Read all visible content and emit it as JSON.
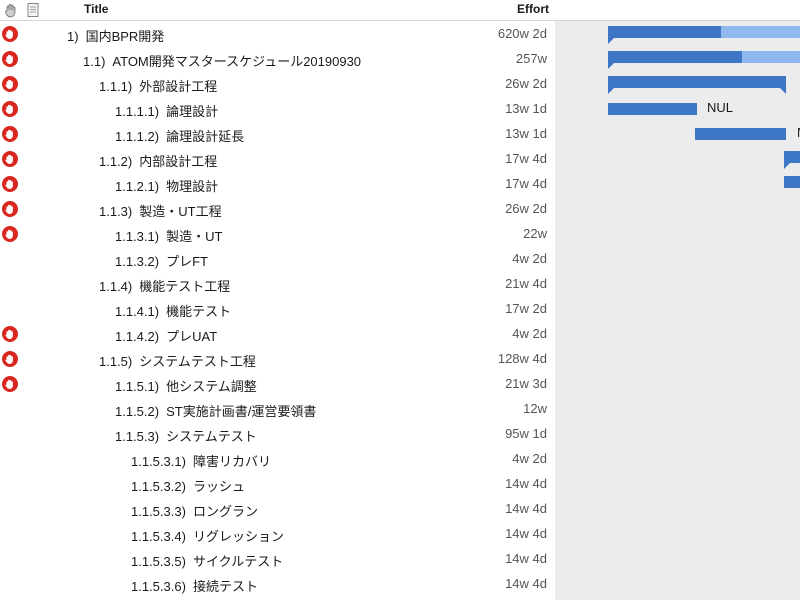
{
  "header": {
    "title_label": "Title",
    "effort_label": "Effort",
    "icons": [
      "hand-icon",
      "document-icon"
    ]
  },
  "colors": {
    "status_red": "#d8271f",
    "bar_dark": "#3d76c4",
    "bar_light": "#8fb8ef",
    "gantt_background": "#ececec"
  },
  "rows": [
    {
      "num": "1)",
      "title": "国内BPR開発",
      "effort": "620w 2d",
      "level": 0,
      "status": true,
      "gantt": {
        "progress": 0.59,
        "summary": true
      }
    },
    {
      "num": "1.1)",
      "title": "ATOM開発マスタースケジュール20190930",
      "effort": "257w",
      "level": 1,
      "status": true,
      "gantt": {
        "progress": 0.7,
        "summary": true
      }
    },
    {
      "num": "1.1.1)",
      "title": "外部設計工程",
      "effort": "26w 2d",
      "level": 2,
      "status": true,
      "gantt": {
        "summary": true
      }
    },
    {
      "num": "1.1.1.1)",
      "title": "論理設計",
      "effort": "13w 1d",
      "level": 3,
      "status": true,
      "gantt": {
        "label": "NUL"
      }
    },
    {
      "num": "1.1.1.2)",
      "title": "論理設計延長",
      "effort": "13w 1d",
      "level": 3,
      "status": true,
      "gantt": {
        "label": "N"
      }
    },
    {
      "num": "1.1.2)",
      "title": "内部設計工程",
      "effort": "17w 4d",
      "level": 2,
      "status": true,
      "gantt": {
        "summary": true
      }
    },
    {
      "num": "1.1.2.1)",
      "title": "物理設計",
      "effort": "17w 4d",
      "level": 3,
      "status": true,
      "gantt": {}
    },
    {
      "num": "1.1.3)",
      "title": "製造・UT工程",
      "effort": "26w 2d",
      "level": 2,
      "status": true,
      "gantt": null
    },
    {
      "num": "1.1.3.1)",
      "title": "製造・UT",
      "effort": "22w",
      "level": 3,
      "status": true,
      "gantt": null
    },
    {
      "num": "1.1.3.2)",
      "title": "プレFT",
      "effort": "4w 2d",
      "level": 3,
      "status": false,
      "gantt": null
    },
    {
      "num": "1.1.4)",
      "title": "機能テスト工程",
      "effort": "21w 4d",
      "level": 2,
      "status": false,
      "gantt": null
    },
    {
      "num": "1.1.4.1)",
      "title": "機能テスト",
      "effort": "17w 2d",
      "level": 3,
      "status": false,
      "gantt": null
    },
    {
      "num": "1.1.4.2)",
      "title": "プレUAT",
      "effort": "4w 2d",
      "level": 3,
      "status": true,
      "gantt": null
    },
    {
      "num": "1.1.5)",
      "title": "システムテスト工程",
      "effort": "128w 4d",
      "level": 2,
      "status": true,
      "gantt": null
    },
    {
      "num": "1.1.5.1)",
      "title": "他システム調整",
      "effort": "21w 3d",
      "level": 3,
      "status": true,
      "gantt": null
    },
    {
      "num": "1.1.5.2)",
      "title": "ST実施計画書/運営要領書",
      "effort": "12w",
      "level": 3,
      "status": false,
      "gantt": null
    },
    {
      "num": "1.1.5.3)",
      "title": "システムテスト",
      "effort": "95w 1d",
      "level": 3,
      "status": false,
      "gantt": null
    },
    {
      "num": "1.1.5.3.1)",
      "title": "障害リカバリ",
      "effort": "4w 2d",
      "level": 4,
      "status": false,
      "gantt": null
    },
    {
      "num": "1.1.5.3.2)",
      "title": "ラッシュ",
      "effort": "14w 4d",
      "level": 4,
      "status": false,
      "gantt": null
    },
    {
      "num": "1.1.5.3.3)",
      "title": "ロングラン",
      "effort": "14w 4d",
      "level": 4,
      "status": false,
      "gantt": null
    },
    {
      "num": "1.1.5.3.4)",
      "title": "リグレッション",
      "effort": "14w 4d",
      "level": 4,
      "status": false,
      "gantt": null
    },
    {
      "num": "1.1.5.3.5)",
      "title": "サイクルテスト",
      "effort": "14w 4d",
      "level": 4,
      "status": false,
      "gantt": null
    },
    {
      "num": "1.1.5.3.6)",
      "title": "接続テスト",
      "effort": "14w 4d",
      "level": 4,
      "status": false,
      "gantt": null
    }
  ]
}
